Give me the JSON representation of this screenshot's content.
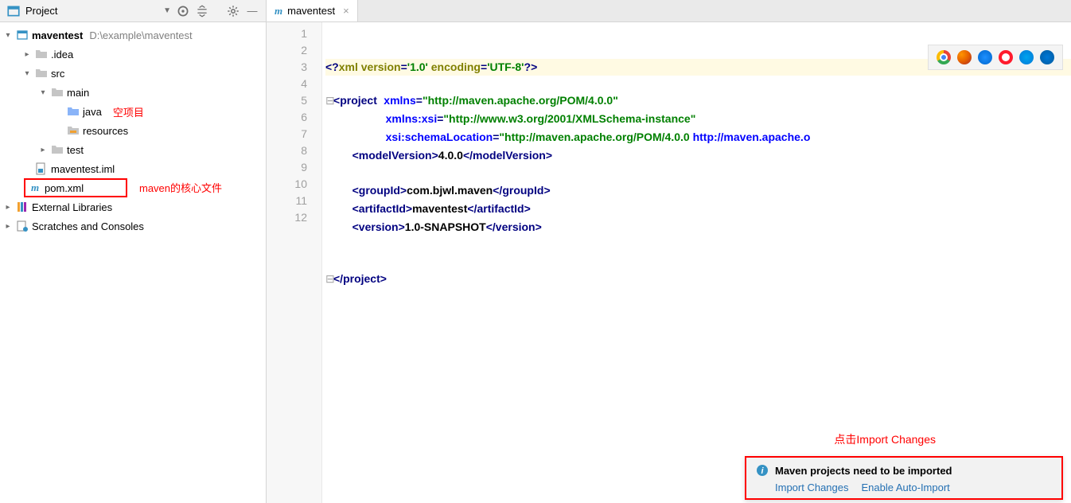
{
  "header": {
    "project_label": "Project"
  },
  "tab": {
    "label": "maventest"
  },
  "tree": {
    "root": {
      "name": "maventest",
      "path": "D:\\example\\maventest"
    },
    "idea": ".idea",
    "src": "src",
    "main": "main",
    "java": "java",
    "java_anno": "空项目",
    "resources": "resources",
    "test": "test",
    "iml": "maventest.iml",
    "pom": "pom.xml",
    "pom_anno": "maven的核心文件",
    "ext_lib": "External Libraries",
    "scratches": "Scratches and Consoles"
  },
  "editor": {
    "lines": {
      "l1": "<?xml version='1.0' encoding='UTF-8'?>",
      "l2a": "project",
      "l2b": "xmlns",
      "l2c": "\"http://maven.apache.org/POM/4.0.0\"",
      "l3a": "xmlns:xsi",
      "l3b": "\"http://www.w3.org/2001/XMLSchema-instance\"",
      "l4a": "xsi:schemaLocation",
      "l4b": "\"http://maven.apache.org/POM/4.0.0 ",
      "l4c": "http://maven.apache.o",
      "l5a": "modelVersion",
      "l5b": "4.0.0",
      "l7a": "groupId",
      "l7b": "com.bjwl.maven",
      "l8a": "artifactId",
      "l8b": "maventest",
      "l9a": "version",
      "l9b": "1.0-SNAPSHOT",
      "l12": "project"
    },
    "line_numbers": [
      "1",
      "2",
      "3",
      "4",
      "5",
      "6",
      "7",
      "8",
      "9",
      "10",
      "11",
      "12"
    ]
  },
  "notif": {
    "anno": "点击Import Changes",
    "title": "Maven projects need to be imported",
    "link1": "Import Changes",
    "link2": "Enable Auto-Import"
  }
}
